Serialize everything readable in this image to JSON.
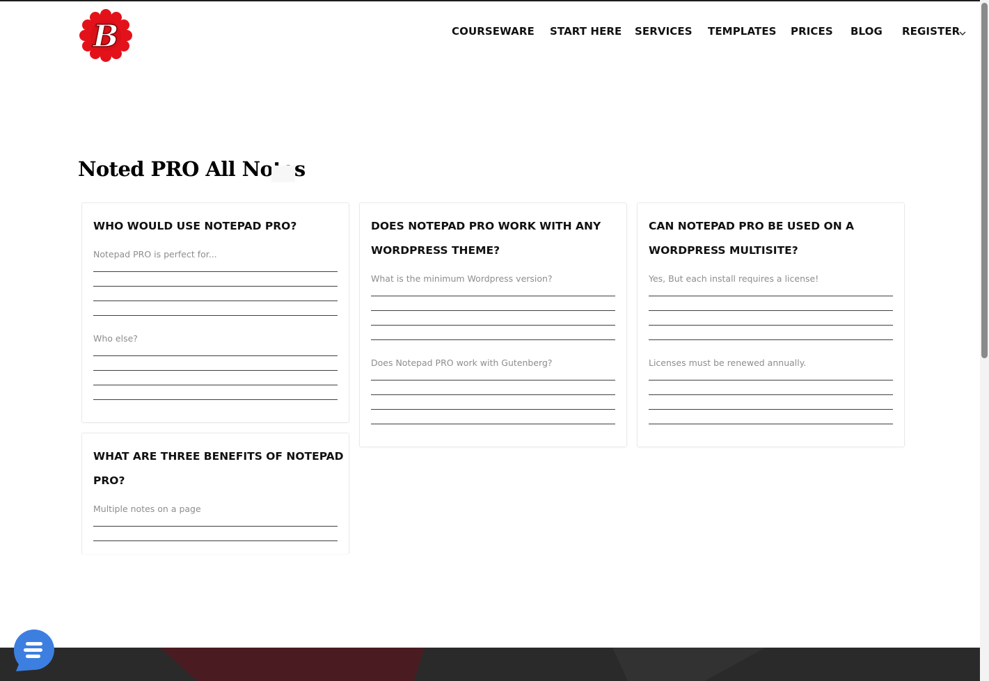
{
  "brand": {
    "logo_letter": "B",
    "colors": {
      "logo_red": "#e3121a",
      "logo_dark_red": "#b20d14",
      "chat_blue": "#3d7fe0",
      "footer_dark": "#2a2a2a",
      "footer_accent": "#4a1c22"
    }
  },
  "nav": {
    "items": [
      "COURSEWARE",
      "START HERE",
      "SERVICES",
      "TEMPLATES",
      "PRICES",
      "BLOG",
      "REGISTER"
    ],
    "dropdown_icon": "chevron-down-icon"
  },
  "page": {
    "title": "Noted PRO All Notes"
  },
  "notes": [
    {
      "title": "WHO WOULD USE NOTEPAD PRO?",
      "prompts": [
        "Notepad PRO is perfect for...",
        "Who else?"
      ]
    },
    {
      "title": "DOES NOTEPAD PRO WORK WITH ANY WORDPRESS THEME?",
      "prompts": [
        "What is the minimum Wordpress version?",
        "Does Notepad PRO work with Gutenberg?"
      ]
    },
    {
      "title": "CAN NOTEPAD PRO BE USED ON A WORDPRESS MULTISITE?",
      "prompts": [
        "Yes, But each install requires a license!",
        "Licenses must be renewed annually."
      ]
    },
    {
      "title": "WHAT ARE THREE BENEFITS OF NOTEPAD PRO?",
      "prompts": [
        "Multiple notes on a page"
      ]
    }
  ],
  "chat_widget": {
    "icon": "chat-bubble-icon"
  }
}
